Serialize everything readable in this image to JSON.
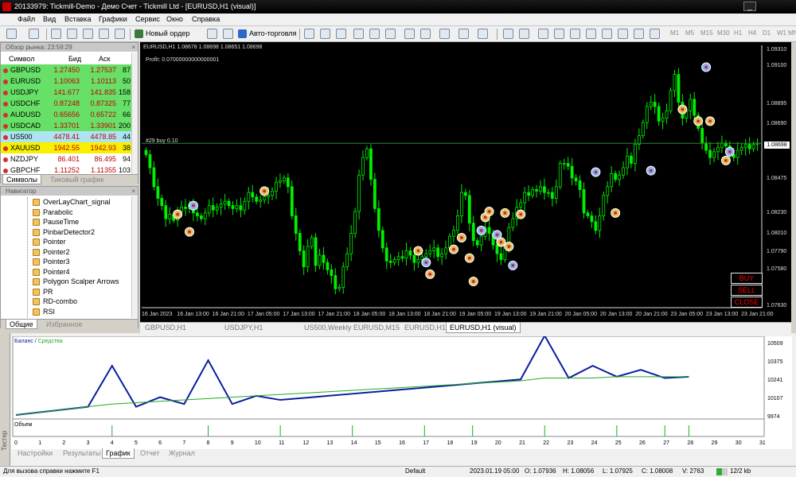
{
  "window": {
    "title": "20133979: Tickmill-Demo - Демо Счет - Tickmill Ltd - [EURUSD,H1 (visual)]"
  },
  "menu": {
    "items": [
      "Файл",
      "Вид",
      "Вставка",
      "Графики",
      "Сервис",
      "Окно",
      "Справка"
    ]
  },
  "toolbar": {
    "new_order": "Новый ордер",
    "autotrade": "Авто-торговля",
    "timeframes": [
      "M1",
      "M5",
      "M15",
      "M30",
      "H1",
      "H4",
      "D1",
      "W1",
      "MN"
    ]
  },
  "market_watch": {
    "header": "Обзор рынка: 23:59:29",
    "columns": [
      "Символ",
      "Бид",
      "Аск",
      ""
    ],
    "rows": [
      {
        "symbol": "GBPUSD",
        "bid": "1.27450",
        "ask": "1.27537",
        "spread": "87",
        "bg": "#66e066",
        "dot": "#d03030"
      },
      {
        "symbol": "EURUSD",
        "bid": "1.10063",
        "ask": "1.10113",
        "spread": "50",
        "bg": "#66e066",
        "dot": "#d03030"
      },
      {
        "symbol": "USDJPY",
        "bid": "141.677",
        "ask": "141.835",
        "spread": "158",
        "bg": "#66e066",
        "dot": "#d03030"
      },
      {
        "symbol": "USDCHF",
        "bid": "0.87248",
        "ask": "0.87325",
        "spread": "77",
        "bg": "#66e066",
        "dot": "#d03030"
      },
      {
        "symbol": "AUDUSD",
        "bid": "0.65656",
        "ask": "0.65722",
        "spread": "66",
        "bg": "#66e066",
        "dot": "#d03030"
      },
      {
        "symbol": "USDCAD",
        "bid": "1.33701",
        "ask": "1.33901",
        "spread": "200",
        "bg": "#66e066",
        "dot": "#d03030"
      },
      {
        "symbol": "US500",
        "bid": "4478.41",
        "ask": "4478.85",
        "spread": "44",
        "bg": "#aee4f2",
        "dot": "#d03030"
      },
      {
        "symbol": "XAUUSD",
        "bid": "1942.55",
        "ask": "1942.93",
        "spread": "38",
        "bg": "#f8f000",
        "dot": "#d03030"
      },
      {
        "symbol": "NZDJPY",
        "bid": "86.401",
        "ask": "86.495",
        "spread": "94",
        "bg": "#ffffff",
        "dot": "#d03030"
      },
      {
        "symbol": "GBPCHF",
        "bid": "1.11252",
        "ask": "1.11355",
        "spread": "103",
        "bg": "#ffffff",
        "dot": "#d03030"
      }
    ],
    "tabs": [
      "Символы",
      "Тиковый график"
    ]
  },
  "navigator": {
    "header": "Навигатор",
    "items": [
      "OverLayChart_signal",
      "Parabolic",
      "PauseTime",
      "PinbarDetector2",
      "Pointer",
      "Pointer2",
      "Pointer3",
      "Pointer4",
      "Polygon Scalper Arrows",
      "PR",
      "RD-combo",
      "RSI"
    ],
    "tabs": [
      "Общие",
      "Избранное"
    ]
  },
  "chart": {
    "info": "EURUSD,H1 1.08678 1.08698 1.08651 1.08698",
    "profit": "Profit: 0.07000000000000001",
    "buy_label": "#29 buy 0.10",
    "price_label": "1.08698",
    "buttons": {
      "buy": "BUY",
      "sell": "SELL",
      "close": "CLOSE"
    },
    "colors": {
      "bull": "#00ee00",
      "bear": "#00ee00",
      "buy_line": "#00aa00",
      "bg": "#000000"
    }
  },
  "chart_tabs": [
    "GBPUSD,H1",
    "USDJPY,H1",
    "US500,Weekly",
    "EURUSD,M15",
    "EURUSD,H1",
    "EURUSD,H1 (visual)"
  ],
  "tester": {
    "side_label": "Тестер",
    "legend_balance": "Баланс",
    "legend_equity": "Средства",
    "volume_label": "Объем",
    "tabs": [
      "Настройки",
      "Результаты",
      "График",
      "Отчет",
      "Журнал"
    ],
    "colors": {
      "balance": "#0a1ea0",
      "equity": "#22aa22"
    }
  },
  "status": {
    "help": "Для вызова справки нажмите F1",
    "profile": "Default",
    "time": "2023.01.19 05:00",
    "o": "O: 1.07936",
    "h": "H: 1.08056",
    "l": "L: 1.07925",
    "c": "C: 1.08008",
    "v": "V: 2763",
    "traffic": "12/2 kb"
  },
  "chart_data": [
    {
      "type": "candlestick",
      "title": "EURUSD,H1",
      "x_tick_labels": [
        "16 Jan 2023",
        "16 Jan 13:00",
        "16 Jan 21:00",
        "17 Jan 05:00",
        "17 Jan 13:00",
        "17 Jan 21:00",
        "18 Jan 05:00",
        "18 Jan 13:00",
        "18 Jan 21:00",
        "19 Jan 05:00",
        "19 Jan 13:00",
        "19 Jan 21:00",
        "20 Jan 05:00",
        "20 Jan 13:00",
        "20 Jan 21:00",
        "23 Jan 05:00",
        "23 Jan 13:00",
        "23 Jan 21:00"
      ],
      "y_tick_labels": [
        "1.09310",
        "1.09100",
        "1.08895",
        "1.08690",
        "1.08475",
        "1.08230",
        "1.08010",
        "1.07790",
        "1.07580",
        "1.07630"
      ],
      "ylim": [
        1.0757,
        1.0937
      ],
      "close": [
        1.0862,
        1.0853,
        1.084,
        1.0832,
        1.0827,
        1.0818,
        1.0821,
        1.0817,
        1.0823,
        1.0826,
        1.0825,
        1.0828,
        1.0822,
        1.082,
        1.0818,
        1.0822,
        1.0827,
        1.0824,
        1.0826,
        1.0828,
        1.083,
        1.0827,
        1.0825,
        1.0827,
        1.0824,
        1.083,
        1.0836,
        1.0833,
        1.083,
        1.0831,
        1.0833,
        1.0834,
        1.0837,
        1.0843,
        1.0844,
        1.0846,
        1.084,
        1.082,
        1.0808,
        1.0796,
        1.0785,
        1.0799,
        1.0805,
        1.0786,
        1.0793,
        1.0788,
        1.0783,
        1.0779,
        1.077,
        1.0771,
        1.0785,
        1.0794,
        1.0808,
        1.0823,
        1.0848,
        1.086,
        1.0866,
        1.0845,
        1.0825,
        1.081,
        1.0798,
        1.0789,
        1.0788,
        1.079,
        1.0792,
        1.0791,
        1.0796,
        1.0793,
        1.0788,
        1.079,
        1.0792,
        1.0794,
        1.0796,
        1.0798,
        1.0792,
        1.0794,
        1.0798,
        1.0806,
        1.081,
        1.082,
        1.0836,
        1.0834,
        1.0815,
        1.0803,
        1.08,
        1.0806,
        1.0812,
        1.0808,
        1.08,
        1.0794,
        1.079,
        1.0799,
        1.0812,
        1.0818,
        1.0826,
        1.0829,
        1.0836,
        1.0834,
        1.0838,
        1.0837,
        1.084,
        1.0836,
        1.0836,
        1.0832,
        1.084,
        1.0856,
        1.0856,
        1.0854,
        1.0846,
        1.0844,
        1.0838,
        1.0822,
        1.082,
        1.0816,
        1.081,
        1.082,
        1.0834,
        1.084,
        1.0849,
        1.0845,
        1.0848,
        1.0853,
        1.0861,
        1.0856,
        1.0869,
        1.0875,
        1.0884,
        1.0895,
        1.0898,
        1.0895,
        1.0885,
        1.0887,
        1.0892,
        1.0906,
        1.0917,
        1.0898,
        1.0887,
        1.0892,
        1.09,
        1.0889,
        1.088,
        1.087,
        1.0865,
        1.086,
        1.0864,
        1.0867,
        1.087,
        1.0868,
        1.0862,
        1.086,
        1.0865,
        1.0867,
        1.0869,
        1.0866,
        1.0869,
        1.087
      ]
    },
    {
      "type": "line",
      "title": "",
      "x": [
        0,
        1,
        2,
        3,
        4,
        5,
        6,
        7,
        8,
        9,
        10,
        11,
        12,
        13,
        14,
        15,
        16,
        17,
        18,
        19,
        20,
        21,
        22,
        23,
        24,
        25,
        26,
        27,
        28,
        29,
        30,
        31
      ],
      "series": [
        {
          "name": "Баланс",
          "values": [
            9980,
            10000,
            10020,
            10040,
            10340,
            10040,
            10110,
            10060,
            10380,
            10060,
            10120,
            10090,
            10105,
            10120,
            10135,
            10150,
            10165,
            10180,
            10195,
            10210,
            10225,
            10240,
            10560,
            10250,
            10340,
            10260,
            10310,
            10250,
            10260
          ]
        },
        {
          "name": "Средства",
          "values": [
            9980,
            10000,
            10020,
            10040,
            10060,
            10070,
            10080,
            10090,
            10100,
            10110,
            10120,
            10130,
            10140,
            10150,
            10160,
            10170,
            10180,
            10190,
            10200,
            10210,
            10220,
            10230,
            10250,
            10250,
            10250,
            10260,
            10260,
            10260,
            10260
          ]
        }
      ],
      "y_tick_labels": [
        "10509",
        "10375",
        "10241",
        "10107",
        "9974"
      ],
      "ylim": [
        9974,
        10509
      ]
    }
  ]
}
